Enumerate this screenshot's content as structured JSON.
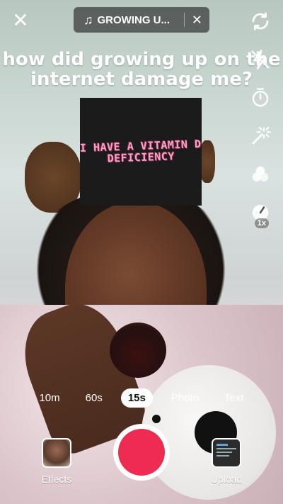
{
  "caption": "how did growing up on the internet damage me?",
  "sticker_text": "I HAVE A VITAMIN D DEFICIENCY",
  "sound": {
    "title": "GROWING U..."
  },
  "side_tools": {
    "speed_badge": "1x"
  },
  "modes": [
    "10m",
    "60s",
    "15s",
    "Photo",
    "Text"
  ],
  "active_mode": "15s",
  "bottom": {
    "effects_label": "Effects",
    "upload_label": "Upload"
  },
  "colors": {
    "record_button": "#ee2c51",
    "active_mode_bg": "#ffffff"
  },
  "icons": [
    "close-icon",
    "music-note-icon",
    "flip-camera-icon",
    "flash-off-icon",
    "timer-icon",
    "beauty-wand-icon",
    "filters-icon",
    "speed-icon"
  ]
}
